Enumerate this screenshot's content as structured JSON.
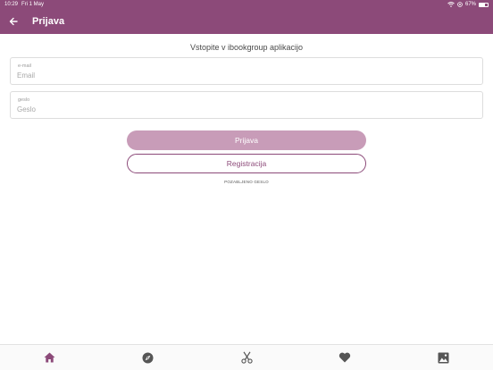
{
  "status_bar": {
    "time": "10:29",
    "date": "Fri 1 May",
    "battery": "67%",
    "battery_level": 0.67
  },
  "app_bar": {
    "title": "Prijava"
  },
  "login": {
    "heading": "Vstopite v ibookgroup aplikacijo",
    "email": {
      "label": "e-mail",
      "placeholder": "Email"
    },
    "password": {
      "label": "geslo",
      "placeholder": "Geslo"
    },
    "login_button": "Prijava",
    "register_button": "Registracija",
    "forgot_password": "POZABLJENO GESLO"
  },
  "tabs": [
    {
      "icon": "home-icon",
      "active": true
    },
    {
      "icon": "compass-icon",
      "active": false
    },
    {
      "icon": "scissors-icon",
      "active": false
    },
    {
      "icon": "heart-icon",
      "active": false
    },
    {
      "icon": "image-icon",
      "active": false
    }
  ],
  "colors": {
    "primary": "#8c4a79",
    "primary_light": "#c89cb8",
    "icon": "#555555"
  }
}
